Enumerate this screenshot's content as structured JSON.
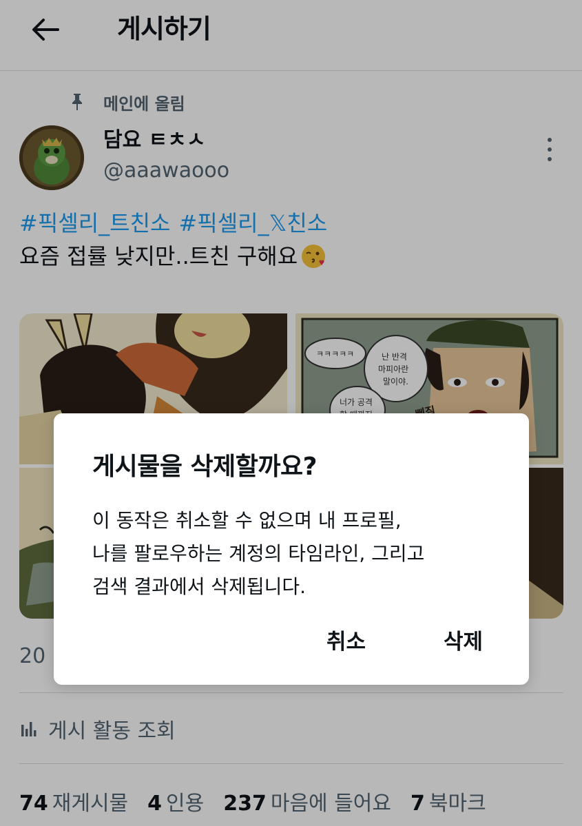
{
  "header": {
    "title": "게시하기"
  },
  "pinned": {
    "label": "메인에 올림"
  },
  "author": {
    "display_name": "담요 ㅌㅊㅅ",
    "handle": "@aaawaooo"
  },
  "tweet": {
    "hashtags": [
      "#픽셀리_트친소",
      "#픽셀리_𝕏친소"
    ],
    "body": "요즘 접률 낮지만..트친 구해요",
    "emoji": "kissing-face-icon"
  },
  "media": {
    "comic_text": {
      "laugh": "ㅋㅋㅋㅋㅋ",
      "bubble1": [
        "난 반격",
        "마피아란",
        "말이야."
      ],
      "bubble2": [
        "너가 공격",
        "할 때까지"
      ],
      "sfx": "삐질"
    }
  },
  "timestamp": "20",
  "activity": {
    "label": "게시 활동 조회"
  },
  "stats": [
    {
      "num": "74",
      "label": "재게시물"
    },
    {
      "num": "4",
      "label": "인용"
    },
    {
      "num": "237",
      "label": "마음에 들어요"
    },
    {
      "num": "7",
      "label": "북마크"
    }
  ],
  "dialog": {
    "title": "게시물을 삭제할까요?",
    "message_lines": [
      "이 동작은 취소할 수 없으며 내 프로필,",
      "나를 팔로우하는 계정의 타임라인, 그리고",
      "검색 결과에서 삭제됩니다."
    ],
    "cancel_label": "취소",
    "delete_label": "삭제"
  },
  "colors": {
    "link": "#1d9bf0",
    "secondary_text": "#536471",
    "divider": "#d7dbdf"
  }
}
